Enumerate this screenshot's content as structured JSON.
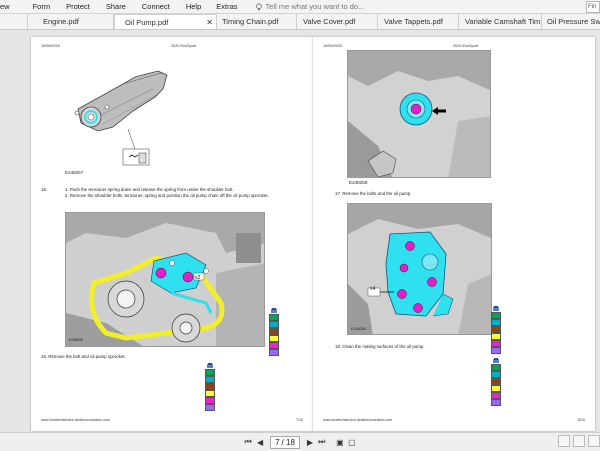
{
  "menubar": {
    "items": [
      "ew",
      "Form",
      "Protect",
      "Share",
      "Connect",
      "Help",
      "Extras"
    ],
    "tell_me": "Tell me what you want to do...",
    "find_label": "Fin"
  },
  "tabs": [
    {
      "label": "Engine.pdf",
      "active": false
    },
    {
      "label": "Oil Pump.pdf",
      "active": true
    },
    {
      "label": "Timing Chain.pdf",
      "active": false
    },
    {
      "label": "Valve Cover.pdf",
      "active": false
    },
    {
      "label": "Valve Tappets.pdf",
      "active": false
    },
    {
      "label": "Variable Camshaft Tim...",
      "active": false
    },
    {
      "label": "Oil Pressure Switc",
      "active": false
    }
  ],
  "left_page": {
    "date": "19/06/2020",
    "model": "2020 EcoSport",
    "fig1_label": "E248257",
    "step15_num": "15.",
    "step15_line1": "1. Push the tensioner spring down and release the spring from under the shoulder bolt.",
    "step15_line2": "2. Remove the shoulder bolts, tensioner, spring and position the oil pump chain off the oil pump sprocket.",
    "fig2_label": "E248258",
    "step16": "16. Remove the bolt and oil pump sprocket.",
    "footer_url": "www.fordtechservice.dealerconnection.com",
    "footer_page": "7/10"
  },
  "right_page": {
    "date": "19/06/2020",
    "model": "2020 EcoSport",
    "fig1_label": "E248259",
    "step17": "17. Remove the bolts and the oil pump.",
    "fig2_label": "E248260",
    "x4": "x4",
    "step18": "18. Clean the mating surfaces of the oil pump.",
    "footer_url": "www.fordtechservice.dealerconnection.com",
    "footer_page": "8/10"
  },
  "swatches": {
    "set_a": [
      "#00a651",
      "#00b0c8",
      "#8b4513",
      "#ffff33",
      "#ee22cc",
      "#9966ff"
    ],
    "set_b": [
      "#00a651",
      "#00b0c8",
      "#8b4513",
      "#ffff33",
      "#ee22cc",
      "#9966ff"
    ]
  },
  "navbar": {
    "page_current": "7",
    "page_total": "/ 18"
  },
  "colors": {
    "cyan": "#2ee0f0",
    "magenta": "#e020d0",
    "yellow": "#f2ef2a"
  }
}
